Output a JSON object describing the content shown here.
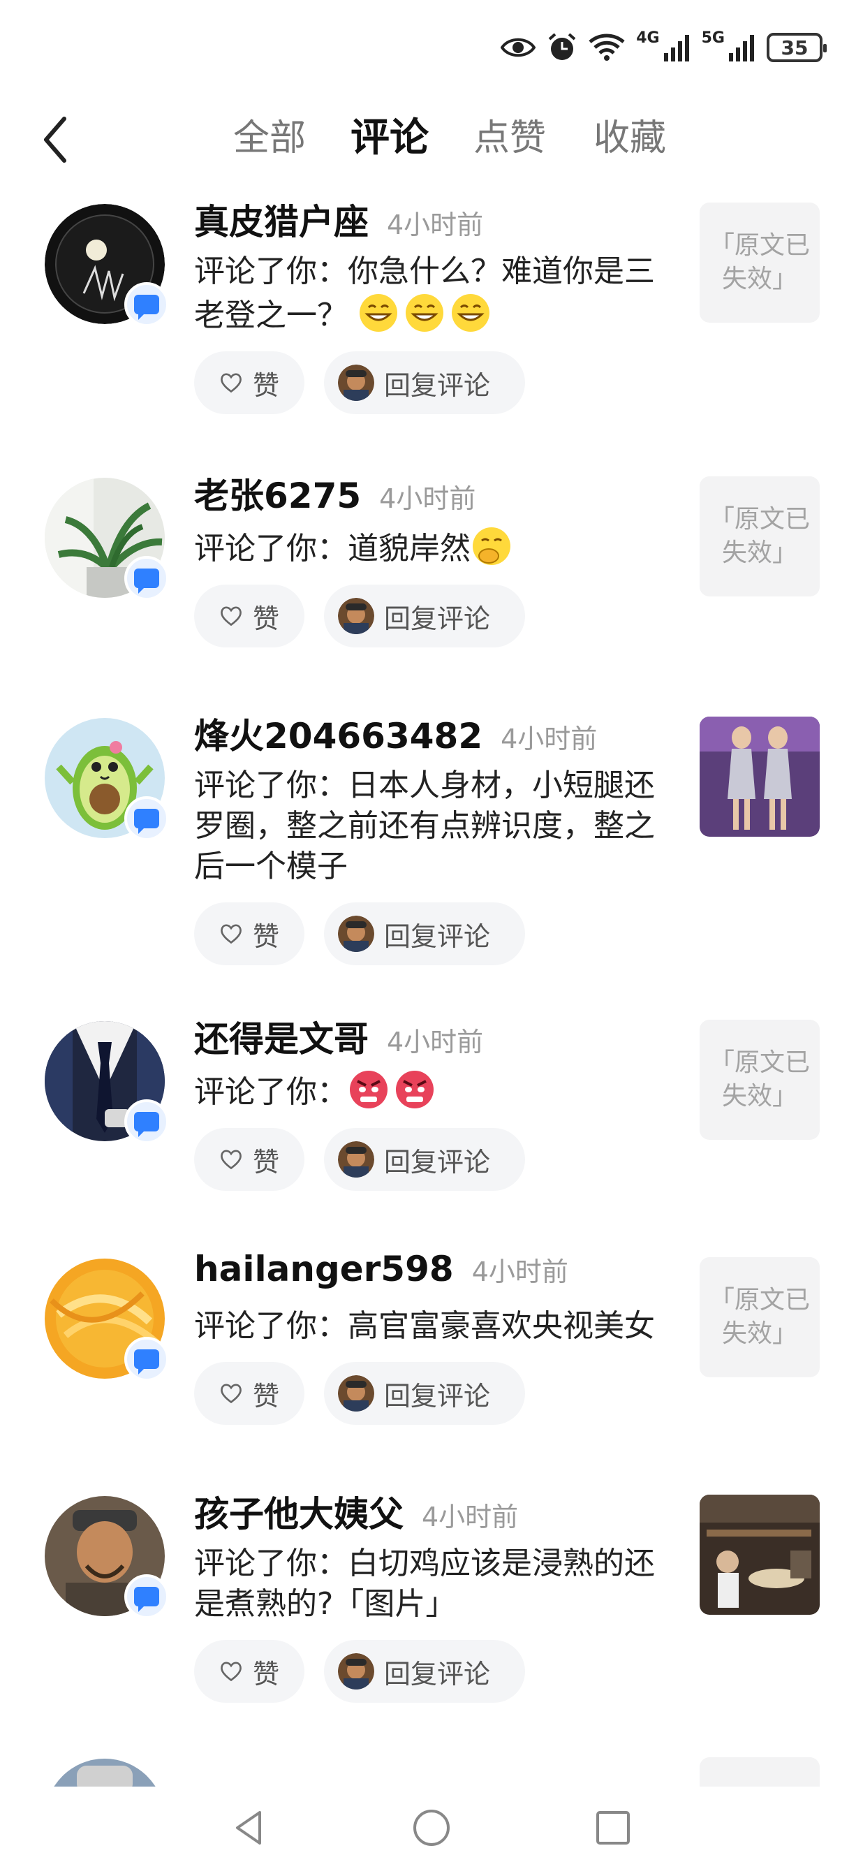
{
  "status_bar": {
    "battery": "35",
    "net_4g": "4G",
    "net_5g": "5G"
  },
  "tabs": [
    {
      "label": "全部",
      "active": false
    },
    {
      "label": "评论",
      "active": true
    },
    {
      "label": "点赞",
      "active": false
    },
    {
      "label": "收藏",
      "active": false
    }
  ],
  "like_label": "赞",
  "reply_label": "回复评论",
  "expired_text": "「原文已失效」",
  "items": [
    {
      "name": "真皮猎户座",
      "time": "4小时前",
      "comment": "评论了你：你急什么？难道你是三老登之一？",
      "emoji_count": 3,
      "emoji_type": "grin",
      "thumb_type": "expired"
    },
    {
      "name": "老张6275",
      "time": "4小时前",
      "comment": "评论了你：道貌岸然",
      "emoji_count": 1,
      "emoji_type": "shush",
      "thumb_type": "expired"
    },
    {
      "name": "烽火204663482",
      "time": "4小时前",
      "comment": "评论了你：日本人身材，小短腿还罗圈，整之前还有点辨识度，整之后一个模子",
      "emoji_count": 0,
      "thumb_type": "image"
    },
    {
      "name": "还得是文哥",
      "time": "4小时前",
      "comment": "评论了你：",
      "emoji_count": 2,
      "emoji_type": "angry",
      "thumb_type": "expired"
    },
    {
      "name": "hailanger598",
      "time": "4小时前",
      "comment": "评论了你：高官富豪喜欢央视美女",
      "emoji_count": 0,
      "thumb_type": "expired"
    },
    {
      "name": "孩子他大姨父",
      "time": "4小时前",
      "comment": "评论了你：白切鸡应该是浸熟的还是煮熟的?「图片」",
      "emoji_count": 0,
      "thumb_type": "image"
    }
  ]
}
